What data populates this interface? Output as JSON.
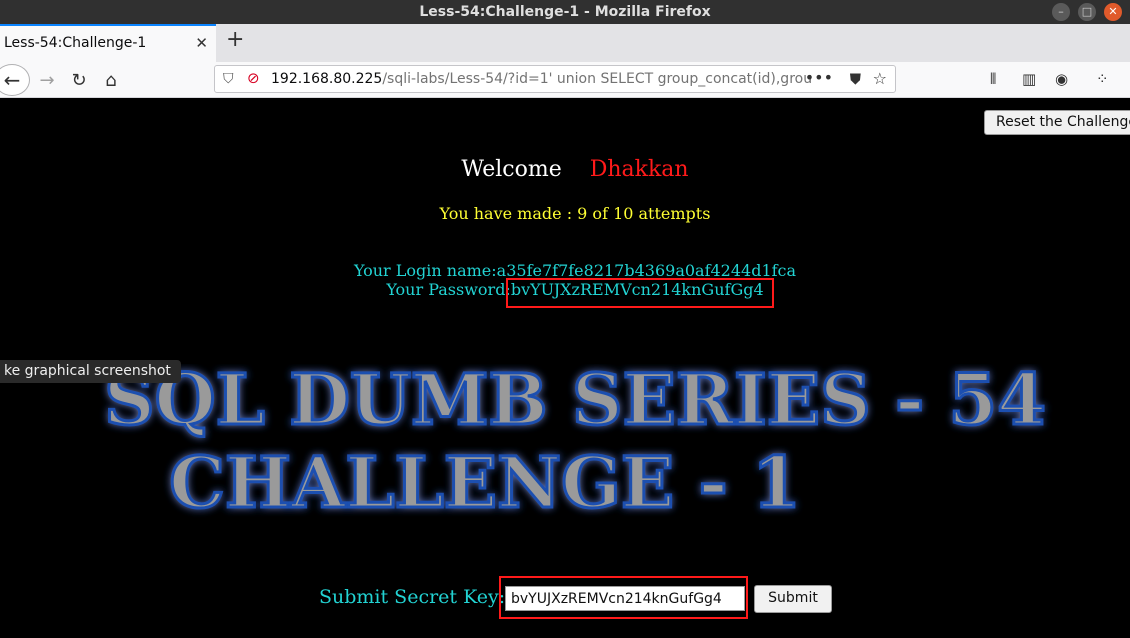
{
  "window": {
    "title": "Less-54:Challenge-1 - Mozilla Firefox"
  },
  "tabs": [
    {
      "label": "Less-54:Challenge-1"
    }
  ],
  "navbar": {
    "url_host": "192.168.80.225",
    "url_path": "/sqli-labs/Less-54/?id=1' union SELECT group_concat(id),grou",
    "url_more": "•••"
  },
  "page": {
    "reset_label": "Reset the Challenge!",
    "welcome_word": "Welcome",
    "welcome_name": "Dhakkan",
    "attempts": "You have made : 9 of 10 attempts",
    "login_label": "Your Login name:",
    "login_value": "a35fe7f7fe8217b4369a0af4244d1fca",
    "password_label": "Your Password:",
    "password_value": "bvYUJXzREMVcn214knGufGg4",
    "tooltip": "ke graphical screenshot",
    "banner_line1": "SQL DUMB SERIES - 54",
    "banner_line2": "CHALLENGE - 1",
    "submit_label": "Submit Secret Key:",
    "key_value": "bvYUJXzREMVcn214knGufGg4",
    "submit_button": "Submit"
  },
  "colors": {
    "welcome_name": "#ff1a1a",
    "attempts": "#ffff33",
    "info": "#22d3d3",
    "highlight": "#ff1a1a"
  }
}
